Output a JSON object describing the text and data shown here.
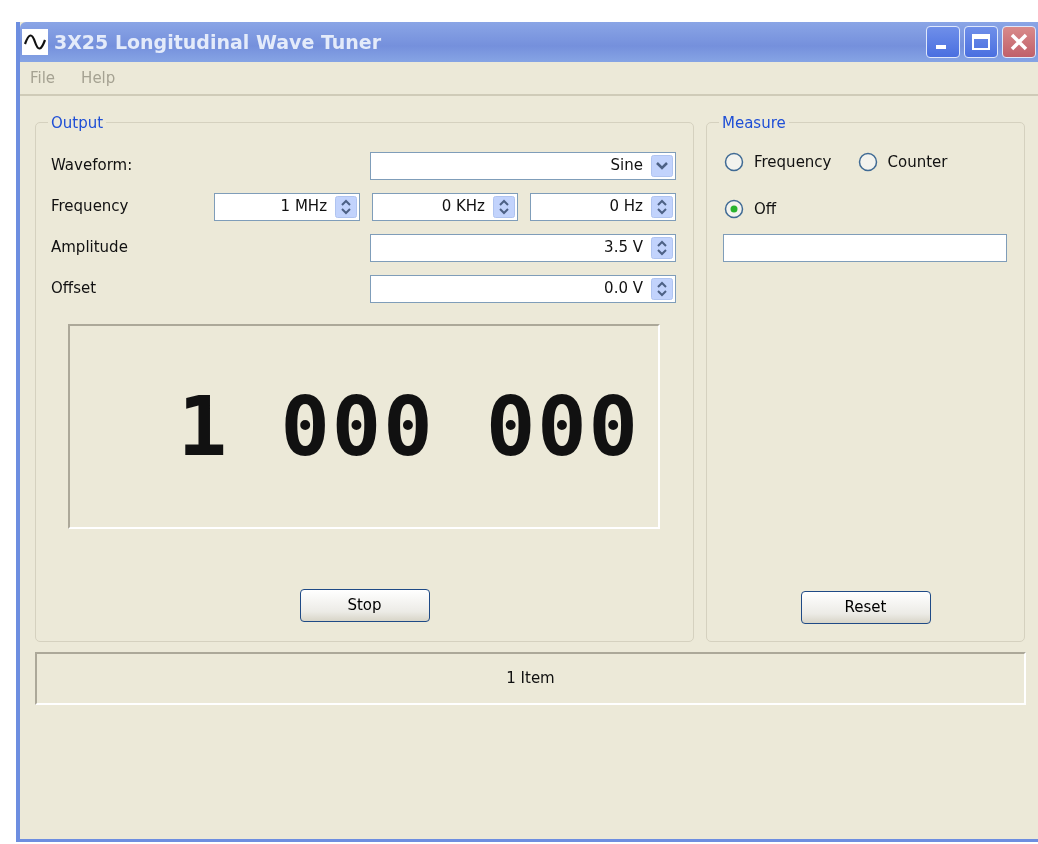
{
  "window": {
    "title": "3X25 Longitudinal Wave Tuner"
  },
  "menu": [
    {
      "label": "File",
      "disabled": true
    },
    {
      "label": "Help",
      "disabled": true
    }
  ],
  "output": {
    "title": "Output",
    "rows": [
      {
        "label": "Waveform:",
        "fields": [
          {
            "kind": "dropdown",
            "value": "Sine"
          }
        ]
      },
      {
        "label": "Frequency",
        "fields": [
          {
            "kind": "spin",
            "value": "1 MHz"
          },
          {
            "kind": "spin",
            "value": "0 KHz"
          },
          {
            "kind": "spin",
            "value": "0 Hz"
          }
        ]
      },
      {
        "label": "Amplitude",
        "fields": [
          {
            "kind": "spin",
            "value": "3.5 V"
          }
        ]
      },
      {
        "label": "Offset",
        "fields": [
          {
            "kind": "spin",
            "value": "0.0 V"
          }
        ]
      }
    ],
    "display": "1 000 000",
    "button": "Stop"
  },
  "measure": {
    "title": "Measure",
    "modes": [
      {
        "label": "Frequency",
        "selected": false
      },
      {
        "label": "Counter",
        "selected": false
      },
      {
        "label": "Off",
        "selected": true
      }
    ],
    "button": "Reset"
  },
  "status_bar": "1 Item"
}
